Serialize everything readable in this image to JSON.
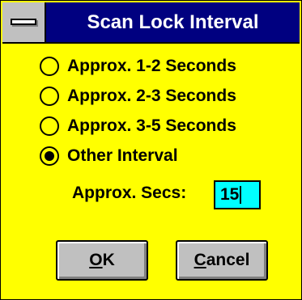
{
  "window": {
    "title": "Scan Lock Interval"
  },
  "options": [
    {
      "label": "Approx. 1-2 Seconds",
      "checked": false
    },
    {
      "label": "Approx. 2-3 Seconds",
      "checked": false
    },
    {
      "label": "Approx. 3-5 Seconds",
      "checked": false
    },
    {
      "label": "Other Interval",
      "checked": true
    }
  ],
  "interval": {
    "label": "Approx. Secs:",
    "value": "15"
  },
  "buttons": {
    "ok_mnemonic": "O",
    "ok_rest": "K",
    "cancel_mnemonic": "C",
    "cancel_rest": "ancel"
  },
  "colors": {
    "background": "#ffff00",
    "titlebar": "#000080",
    "input": "#00ffff"
  }
}
